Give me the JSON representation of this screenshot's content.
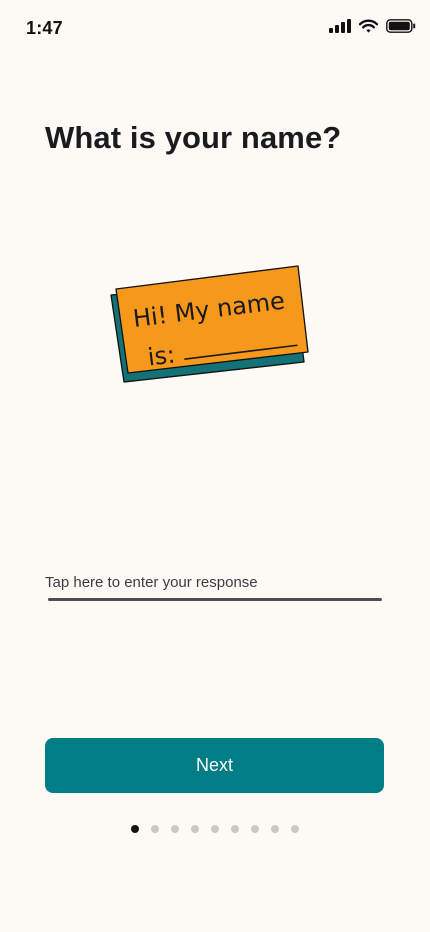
{
  "status_bar": {
    "time": "1:47",
    "icons": [
      "cellular-signal-icon",
      "wifi-icon",
      "battery-icon"
    ]
  },
  "question": {
    "title": "What is your name?"
  },
  "illustration": {
    "name": "name-tag-sticker-illustration",
    "handwritten_text": "Hi! My name is: ________",
    "colors": {
      "tag": "#f6981c",
      "shadow": "#137276"
    }
  },
  "response": {
    "placeholder": "Tap here to enter your response",
    "value": ""
  },
  "next_button": {
    "label": "Next",
    "color": "#017e85"
  },
  "pagination": {
    "total": 9,
    "current": 1
  }
}
